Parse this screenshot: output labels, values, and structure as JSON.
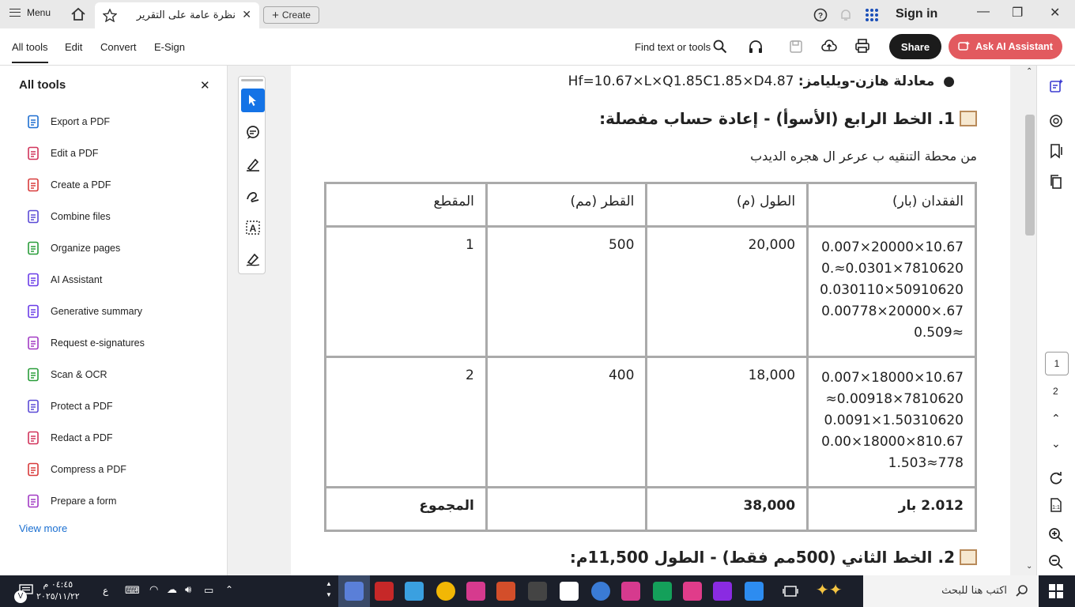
{
  "topbar": {
    "menu_label": "Menu",
    "tab_title": "نظرة عامة على التقرير",
    "create_label": "Create",
    "signin_label": "Sign in"
  },
  "toolbar": {
    "tabs": [
      "All tools",
      "Edit",
      "Convert",
      "E-Sign"
    ],
    "find_label": "Find text or tools",
    "share_label": "Share",
    "ask_ai_label": "Ask AI Assistant"
  },
  "left_panel": {
    "title": "All tools",
    "items": [
      {
        "label": "Export a PDF",
        "icon": "export-pdf-icon",
        "color": "#1f6fd1"
      },
      {
        "label": "Edit a PDF",
        "icon": "edit-pdf-icon",
        "color": "#d1345b"
      },
      {
        "label": "Create a PDF",
        "icon": "create-pdf-icon",
        "color": "#d83b3b"
      },
      {
        "label": "Combine files",
        "icon": "combine-files-icon",
        "color": "#5b4bd6"
      },
      {
        "label": "Organize pages",
        "icon": "organize-pages-icon",
        "color": "#2a9d3a"
      },
      {
        "label": "AI Assistant",
        "icon": "ai-assistant-icon",
        "color": "#6a3de8"
      },
      {
        "label": "Generative summary",
        "icon": "generative-summary-icon",
        "color": "#6a3de8"
      },
      {
        "label": "Request e-signatures",
        "icon": "request-esign-icon",
        "color": "#a23bc4"
      },
      {
        "label": "Scan & OCR",
        "icon": "scan-ocr-icon",
        "color": "#2a9d3a"
      },
      {
        "label": "Protect a PDF",
        "icon": "protect-pdf-icon",
        "color": "#5b4bd6"
      },
      {
        "label": "Redact a PDF",
        "icon": "redact-pdf-icon",
        "color": "#d1345b"
      },
      {
        "label": "Compress a PDF",
        "icon": "compress-pdf-icon",
        "color": "#d83b3b"
      },
      {
        "label": "Prepare a form",
        "icon": "prepare-form-icon",
        "color": "#a23bc4"
      }
    ],
    "view_more": "View more"
  },
  "document": {
    "bullet_formula": "Hf=10.67×L×Q1.85C1.85×D4.87",
    "bullet_label": "معادلة هازن-ويليامز:",
    "heading1": "1. الخط الرابع (الأسوأ) - إعادة حساب مفصلة:",
    "subtext": "من محطة التنقيه ب عرعر ال هجره الديدب",
    "table": {
      "headers": [
        "الفقدان (بار)",
        "الطول (م)",
        "القطر (مم)",
        "المقطع"
      ],
      "rows": [
        {
          "loss": [
            "0.007×20000×10.67",
            "0.≈0.0301×7810620",
            "0.030110×50910620",
            "0.00778×20000×.67",
            "0.509≈"
          ],
          "length": "20,000",
          "diameter": "500",
          "section": "1"
        },
        {
          "loss": [
            "0.007×18000×10.67",
            "≈0.00918×7810620",
            "0.0091×1.50310620",
            "0.00×18000×810.67",
            "1.503≈778"
          ],
          "length": "18,000",
          "diameter": "400",
          "section": "2"
        }
      ],
      "total": {
        "loss": "2.012 بار",
        "length": "38,000",
        "diameter": "",
        "section": "المجموع"
      }
    },
    "heading2": "2. الخط الثاني (500مم فقط) - الطول 11,500م:"
  },
  "pagination": {
    "current": "1",
    "next": "2"
  },
  "taskbar": {
    "search_placeholder": "اكتب هنا للبحث",
    "time": "٠٤:٤٥ م",
    "date": "٢٠٢٥/١١/٢٢",
    "lang": "ع"
  },
  "colors": {
    "share_bg": "#1b1b1b",
    "ask_ai_bg": "#e25a5f",
    "accent": "#1473e6",
    "link": "#1a6fd1"
  }
}
